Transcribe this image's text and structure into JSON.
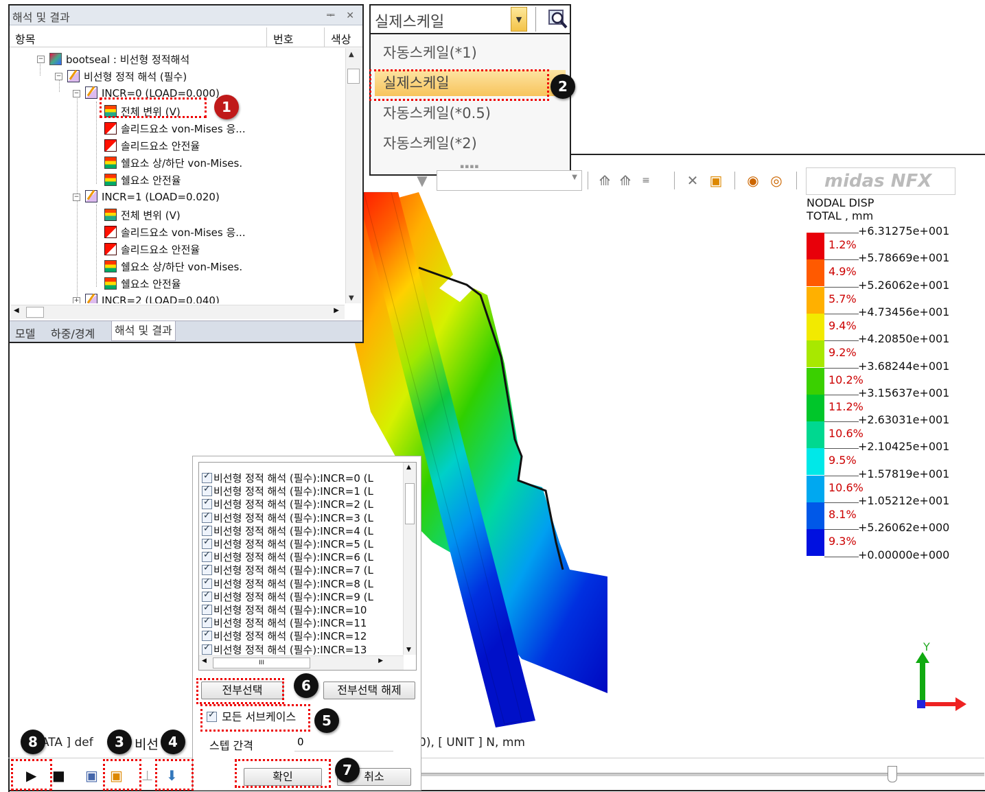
{
  "tree_panel": {
    "title": "해석 및 결과",
    "title_buttons": "ᆍ ✕",
    "columns": [
      "항목",
      "번호",
      "색상"
    ],
    "nodes": [
      {
        "label": "bootseal : 비선형 정적해석",
        "icon": "analysis-icon"
      },
      {
        "label": "비선형 정적 해석 (필수)",
        "icon": "edit-icon"
      },
      {
        "label": "INCR=0 (LOAD=0.000)",
        "icon": "edit-icon"
      },
      {
        "label": "전체 변위 (V)",
        "icon": "displacement-icon"
      },
      {
        "label": "솔리드요소 von-Mises 응...",
        "icon": "solid-stress-icon"
      },
      {
        "label": "솔리드요소 안전율",
        "icon": "solid-safety-icon"
      },
      {
        "label": "쉘요소 상/하단 von-Mises.",
        "icon": "shell-stress-icon"
      },
      {
        "label": "쉘요소 안전율",
        "icon": "shell-safety-icon"
      },
      {
        "label": "INCR=1 (LOAD=0.020)",
        "icon": "edit-icon"
      },
      {
        "label": "전체 변위 (V)",
        "icon": "displacement-icon"
      },
      {
        "label": "솔리드요소 von-Mises 응...",
        "icon": "solid-stress-icon"
      },
      {
        "label": "솔리드요소 안전율",
        "icon": "solid-safety-icon"
      },
      {
        "label": "쉘요소 상/하단 von-Mises.",
        "icon": "shell-stress-icon"
      },
      {
        "label": "쉘요소 안전율",
        "icon": "shell-safety-icon"
      },
      {
        "label": "INCR=2 (LOAD=0.040)",
        "icon": "edit-icon"
      }
    ],
    "tabs": [
      "모델",
      "하중/경계",
      "해석 및 결과"
    ]
  },
  "scale_combo": {
    "value": "실제스케일",
    "options": [
      "자동스케일(*1)",
      "실제스케일",
      "자동스케일(*0.5)",
      "자동스케일(*2)"
    ],
    "selected": "실제스케일"
  },
  "brand": "midas NFX",
  "legend": {
    "title_line1": "NODAL DISP",
    "title_line2": "TOTAL , mm",
    "values": [
      "+6.31275e+001",
      "+5.78669e+001",
      "+5.26062e+001",
      "+4.73456e+001",
      "+4.20850e+001",
      "+3.68244e+001",
      "+3.15637e+001",
      "+2.63031e+001",
      "+2.10425e+001",
      "+1.57819e+001",
      "+1.05212e+001",
      "+5.26062e+000",
      "+0.00000e+000"
    ],
    "percents": [
      "1.2%",
      "4.9%",
      "5.7%",
      "9.4%",
      "9.2%",
      "10.2%",
      "11.2%",
      "10.6%",
      "9.5%",
      "10.6%",
      "8.1%",
      "9.3%"
    ],
    "colors": [
      "#e8000a",
      "#ff5a00",
      "#ffb000",
      "#f2ea00",
      "#a8e800",
      "#3ad000",
      "#00c62a",
      "#00d890",
      "#00e8e8",
      "#00a8f0",
      "#0058e8",
      "#0010e0"
    ]
  },
  "axis": {
    "y_label": "Y"
  },
  "status": {
    "left_text": "ATA ] def",
    "mid_text": "비선",
    "right_text": "0),  [ UNIT ]   N,  mm"
  },
  "sub_dialog": {
    "rows": [
      "비선형 정적 해석 (필수):INCR=0 (L",
      "비선형 정적 해석 (필수):INCR=1 (L",
      "비선형 정적 해석 (필수):INCR=2 (L",
      "비선형 정적 해석 (필수):INCR=3 (L",
      "비선형 정적 해석 (필수):INCR=4 (L",
      "비선형 정적 해석 (필수):INCR=5 (L",
      "비선형 정적 해석 (필수):INCR=6 (L",
      "비선형 정적 해석 (필수):INCR=7 (L",
      "비선형 정적 해석 (필수):INCR=8 (L",
      "비선형 정적 해석 (필수):INCR=9 (L",
      "비선형 정적 해석 (필수):INCR=10",
      "비선형 정적 해석 (필수):INCR=11",
      "비선형 정적 해석 (필수):INCR=12",
      "비선형 정적 해석 (필수):INCR=13"
    ],
    "select_all": "전부선택",
    "deselect_all": "전부선택 해제",
    "all_subcases": "모든 서브케이스",
    "step_label": "스텝 간격",
    "step_value": "0",
    "ok": "확인",
    "cancel": "취소"
  },
  "badges": [
    "1",
    "2",
    "3",
    "4",
    "5",
    "6",
    "7",
    "8"
  ]
}
